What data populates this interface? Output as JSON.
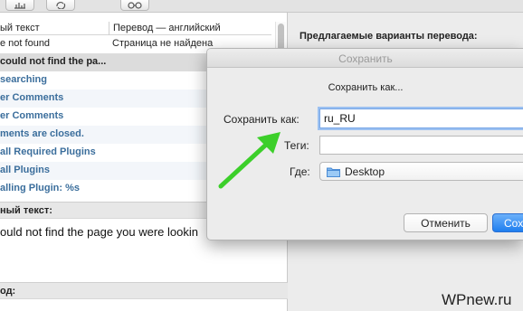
{
  "toolbar": {
    "icons": [
      "chart-icon",
      "refresh-icon",
      "glasses-icon"
    ]
  },
  "table": {
    "col_source": "ый текст",
    "col_translation": "Перевод — английский",
    "rows": [
      {
        "source": "e not found",
        "translation": "Страница не найдена",
        "style": "plain"
      },
      {
        "source": "could not find the pa...",
        "translation": "",
        "style": "header"
      },
      {
        "source": "searching",
        "translation": "",
        "style": "blue"
      },
      {
        "source": "er Comments",
        "translation": "",
        "style": "blue"
      },
      {
        "source": "er Comments",
        "translation": "",
        "style": "blue"
      },
      {
        "source": "ments are closed.",
        "translation": "",
        "style": "blue"
      },
      {
        "source": "all Required Plugins",
        "translation": "",
        "style": "blue"
      },
      {
        "source": "all Plugins",
        "translation": "",
        "style": "blue"
      },
      {
        "source": "alling Plugin: %s",
        "translation": "",
        "style": "blue"
      }
    ]
  },
  "source_panel": {
    "label": "ный текст:",
    "text": "ould not find the page you were lookin"
  },
  "translation_panel": {
    "label": "од:"
  },
  "right_panel": {
    "title": "Предлагаемые варианты перевода:"
  },
  "dialog": {
    "title": "Сохранить",
    "prompt": "Сохранить как...",
    "save_as_label": "Сохранить как:",
    "save_as_value": "ru_RU",
    "tags_label": "Теги:",
    "tags_value": "",
    "where_label": "Где:",
    "where_value": "Desktop",
    "cancel_label": "Отменить",
    "save_label": "Сох"
  },
  "watermark": "WPnew.ru",
  "colors": {
    "accent": "#1f7eef",
    "row_blue_text": "#3b6e9c",
    "arrow": "#3ccf2a"
  }
}
